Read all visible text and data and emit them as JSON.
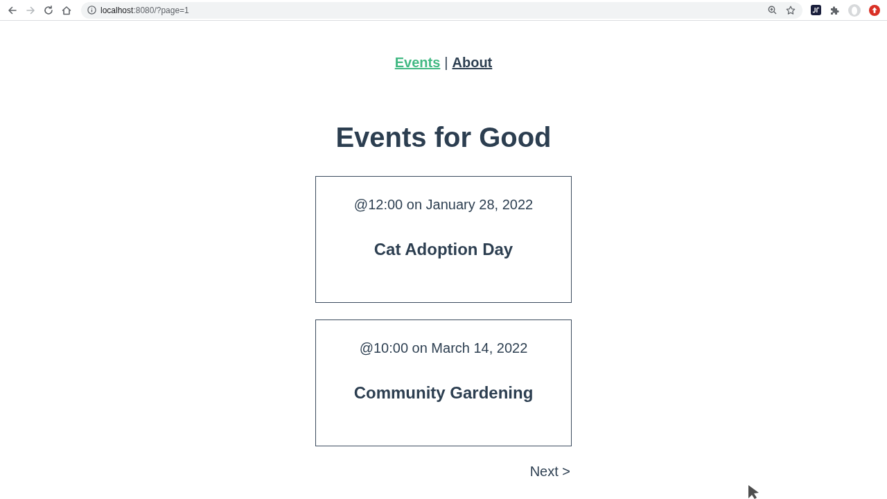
{
  "browser": {
    "nav_buttons": [
      {
        "kind": "back",
        "disabled": false
      },
      {
        "kind": "forward",
        "disabled": true
      },
      {
        "kind": "reload",
        "disabled": false
      },
      {
        "kind": "home",
        "disabled": false
      }
    ],
    "address": {
      "host": "localhost",
      "path": ":8080/?page=1"
    }
  },
  "nav": {
    "links": [
      {
        "label": "Events",
        "selected": true
      },
      {
        "label": "About",
        "selected": false
      }
    ],
    "separator": "|"
  },
  "heading": "Events for Good",
  "events": [
    {
      "when": "@12:00 on January 28, 2022",
      "title": "Cat Adoption Day"
    },
    {
      "when": "@10:00 on March 14, 2022",
      "title": "Community Gardening"
    }
  ],
  "pagination": {
    "next": "Next >"
  }
}
